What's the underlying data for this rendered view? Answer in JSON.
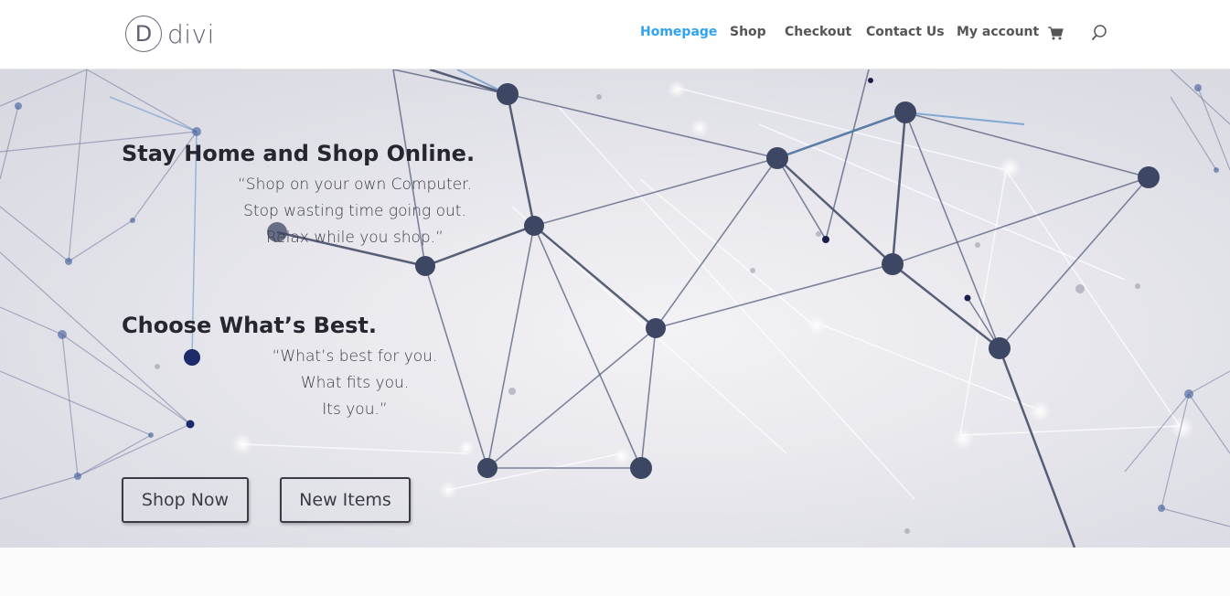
{
  "brand": {
    "logo_letter": "D",
    "logo_word": "divi"
  },
  "nav": {
    "items": [
      {
        "label": "Homepage",
        "active": true
      },
      {
        "label": "Shop",
        "active": false
      },
      {
        "label": "Checkout",
        "active": false
      },
      {
        "label": "Contact Us",
        "active": false
      },
      {
        "label": "My account",
        "active": false
      }
    ],
    "cart_icon": "cart-icon",
    "search_icon": "search-icon"
  },
  "hero": {
    "block1": {
      "title": "Stay Home and Shop Online.",
      "lines": [
        "“Shop on your own Computer.",
        "Stop wasting time going out.",
        "Relax while you shop.”"
      ]
    },
    "block2": {
      "title": "Choose What’s Best.",
      "lines": [
        "“What’s best for you.",
        "What fits you.",
        "Its you.”"
      ]
    },
    "buttons": {
      "shop_now": "Shop Now",
      "new_items": "New Items"
    }
  },
  "colors": {
    "accent": "#2ea3f2",
    "text_dark": "#262631",
    "nav_text": "#555555",
    "node_color": "#3d4663"
  }
}
